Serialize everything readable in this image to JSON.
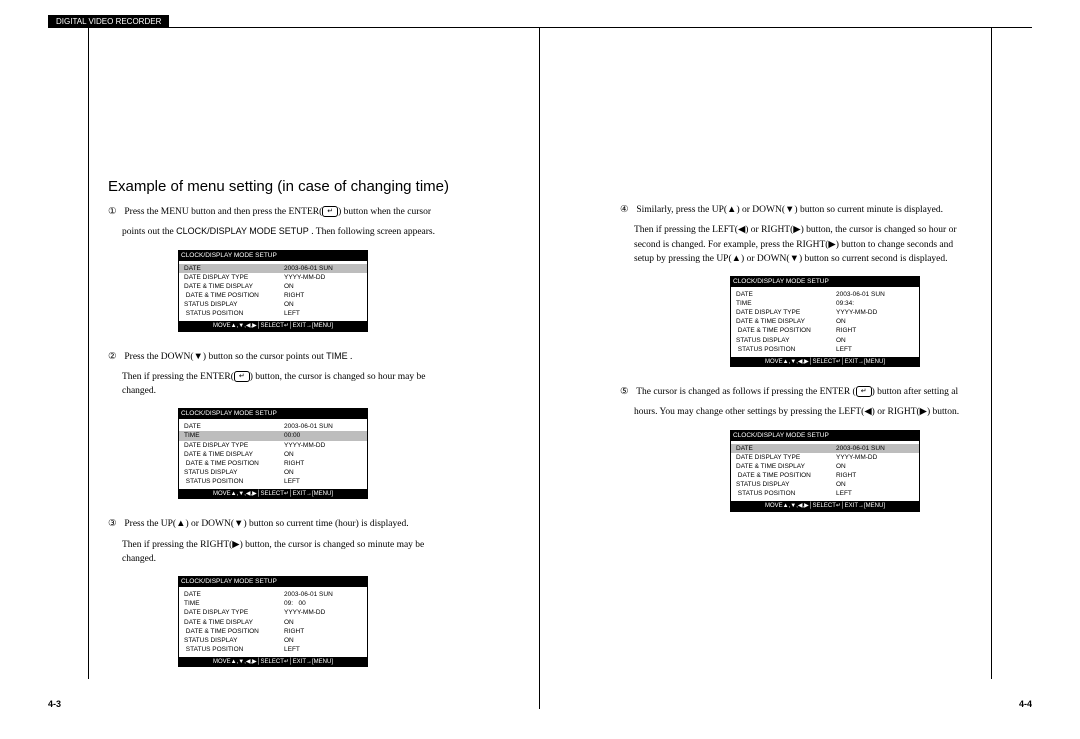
{
  "header": "DIGITAL VIDEO RECORDER",
  "left": {
    "title": "Example of menu setting (in case of changing time)",
    "step1_a": "Press the MENU button and then press the ENTER(",
    "step1_b": ") button when the cursor",
    "step1_c": "points out the ",
    "step1_emph": "CLOCK/DISPLAY MODE SETUP",
    "step1_d": " . Then following screen appears.",
    "step2_a": "Press the DOWN(▼) button so the cursor points out ",
    "step2_emph": "TIME",
    "step2_b": " .",
    "step2_c": "Then if pressing the ENTER(",
    "step2_d": ") button, the cursor is changed so hour may be",
    "step2_e": "changed.",
    "step3_a": "Press the UP(▲) or DOWN(▼) button so current time (hour) is displayed.",
    "step3_b": "Then if pressing the RIGHT(▶) button, the cursor is changed so minute may be",
    "step3_c": "changed.",
    "pagenum": "4-3",
    "screens": [
      {
        "title": "CLOCK/DISPLAY MODE SETUP",
        "rows": [
          {
            "lbl": "DATE",
            "val": "2003-06-01 SUN",
            "hi": true
          },
          {
            "lbl": "",
            "val": ""
          },
          {
            "lbl": "DATE DISPLAY TYPE",
            "val": "YYYY-MM-DD"
          },
          {
            "lbl": "DATE & TIME DISPLAY",
            "val": "ON"
          },
          {
            "lbl": " DATE & TIME POSITION",
            "val": "RIGHT"
          },
          {
            "lbl": "STATUS DISPLAY",
            "val": "ON"
          },
          {
            "lbl": " STATUS POSITION",
            "val": "LEFT"
          }
        ],
        "footer": "MOVE▲,▼,◀,▶│SELECT↵│EXIT→[MENU]"
      },
      {
        "title": "CLOCK/DISPLAY MODE SETUP",
        "rows": [
          {
            "lbl": "DATE",
            "val": "2003-06-01 SUN"
          },
          {
            "lbl": "TIME",
            "val": "00:00",
            "hi": true
          },
          {
            "lbl": "DATE DISPLAY TYPE",
            "val": "YYYY-MM-DD"
          },
          {
            "lbl": "DATE & TIME DISPLAY",
            "val": "ON"
          },
          {
            "lbl": " DATE & TIME POSITION",
            "val": "RIGHT"
          },
          {
            "lbl": "STATUS DISPLAY",
            "val": "ON"
          },
          {
            "lbl": " STATUS POSITION",
            "val": "LEFT"
          }
        ],
        "footer": "MOVE▲,▼,◀,▶│SELECT↵│EXIT→[MENU]"
      },
      {
        "title": "CLOCK/DISPLAY MODE SETUP",
        "rows": [
          {
            "lbl": "DATE",
            "val": "2003-06-01 SUN"
          },
          {
            "lbl": "TIME",
            "val": "09:   00"
          },
          {
            "lbl": "DATE DISPLAY TYPE",
            "val": "YYYY-MM-DD"
          },
          {
            "lbl": "DATE & TIME DISPLAY",
            "val": "ON"
          },
          {
            "lbl": " DATE & TIME POSITION",
            "val": "RIGHT"
          },
          {
            "lbl": "STATUS DISPLAY",
            "val": "ON"
          },
          {
            "lbl": " STATUS POSITION",
            "val": "LEFT"
          }
        ],
        "footer": "MOVE▲,▼,◀,▶│SELECT↵│EXIT→[MENU]"
      }
    ]
  },
  "right": {
    "step4_a": "Similarly, press the UP(▲) or DOWN(▼) button so current minute is displayed.",
    "step4_b": "Then if pressing the LEFT(◀) or RIGHT(▶) button, the cursor is changed so hour or",
    "step4_c": "second is changed. For example, press the RIGHT(▶) button to change seconds and",
    "step4_d": "setup by pressing the UP(▲) or DOWN(▼) button so current second is displayed.",
    "step5_a": "The cursor is changed as follows if pressing the ENTER (",
    "step5_b": ") button after setting al",
    "step5_c": "hours. You may change other settings by pressing the LEFT(◀) or RIGHT(▶) button.",
    "pagenum": "4-4",
    "screens": [
      {
        "title": "CLOCK/DISPLAY MODE SETUP",
        "rows": [
          {
            "lbl": "DATE",
            "val": "2003-06-01 SUN"
          },
          {
            "lbl": "TIME",
            "val": "09:34:"
          },
          {
            "lbl": "DATE DISPLAY TYPE",
            "val": "YYYY-MM-DD"
          },
          {
            "lbl": "DATE & TIME DISPLAY",
            "val": "ON"
          },
          {
            "lbl": " DATE & TIME POSITION",
            "val": "RIGHT"
          },
          {
            "lbl": "STATUS DISPLAY",
            "val": "ON"
          },
          {
            "lbl": " STATUS POSITION",
            "val": "LEFT"
          }
        ],
        "footer": "MOVE▲,▼,◀,▶│SELECT↵│EXIT→[MENU]"
      },
      {
        "title": "CLOCK/DISPLAY MODE SETUP",
        "rows": [
          {
            "lbl": "DATE",
            "val": "2003-06-01 SUN",
            "hi": true
          },
          {
            "lbl": "",
            "val": ""
          },
          {
            "lbl": "DATE DISPLAY TYPE",
            "val": "YYYY-MM-DD"
          },
          {
            "lbl": "DATE & TIME DISPLAY",
            "val": "ON"
          },
          {
            "lbl": " DATE & TIME POSITION",
            "val": "RIGHT"
          },
          {
            "lbl": "STATUS DISPLAY",
            "val": "ON"
          },
          {
            "lbl": " STATUS POSITION",
            "val": "LEFT"
          }
        ],
        "footer": "MOVE▲,▼,◀,▶│SELECT↵│EXIT→[MENU]"
      }
    ]
  },
  "enter_glyph": "↵"
}
